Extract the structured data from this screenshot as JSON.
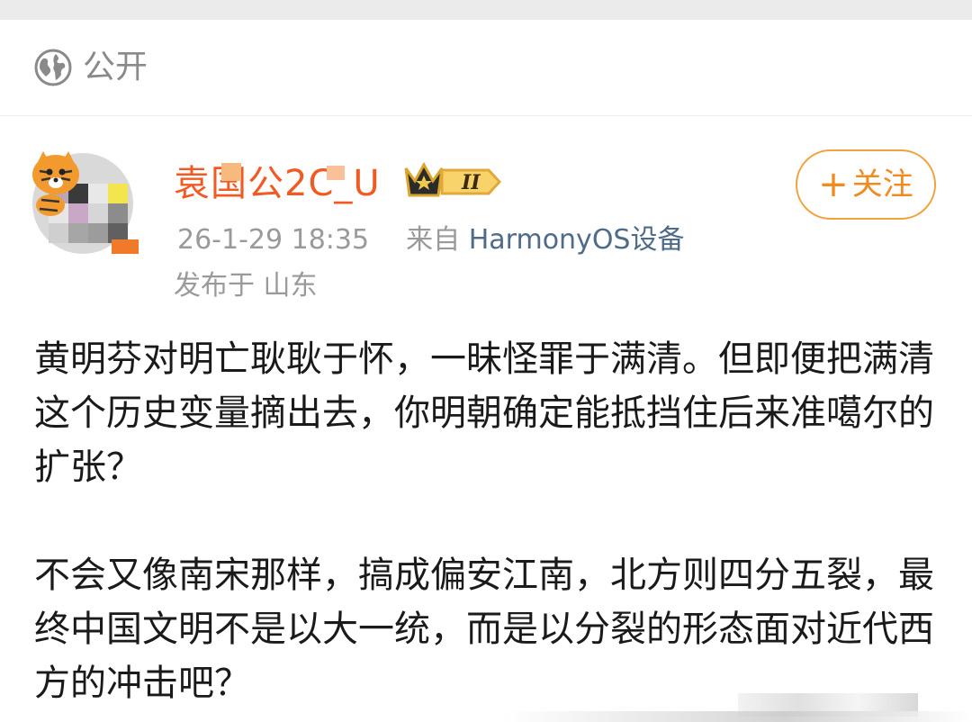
{
  "visibility": {
    "label": "公开",
    "icon": "globe-icon"
  },
  "author": {
    "name": "袁国公2C_U",
    "avatar_icon": "tiger-avatar",
    "badge_icon": "crown-vip-badge",
    "badge_text": "II"
  },
  "meta": {
    "time": "26-1-29 18:35",
    "from_label": "来自",
    "source": "HarmonyOS设备",
    "location": "发布于 山东"
  },
  "follow": {
    "plus": "+",
    "label": "关注"
  },
  "post": {
    "paragraph1": "黄明芬对明亡耿耿于怀，一昧怪罪于满清。但即便把满清这个历史变量摘出去，你明朝确定能抵挡住后来准噶尔的扩张？",
    "paragraph2": "不会又像南宋那样，搞成偏安江南，北方则四分五裂，最终中国文明不是以大一统，而是以分裂的形态面对近代西方的冲击吧？"
  },
  "colors": {
    "username": "#f25a24",
    "source_link": "#4f6b8a",
    "follow_border": "#f2a23c",
    "follow_text": "#f18a1f",
    "muted_text": "#9a9a9a"
  }
}
